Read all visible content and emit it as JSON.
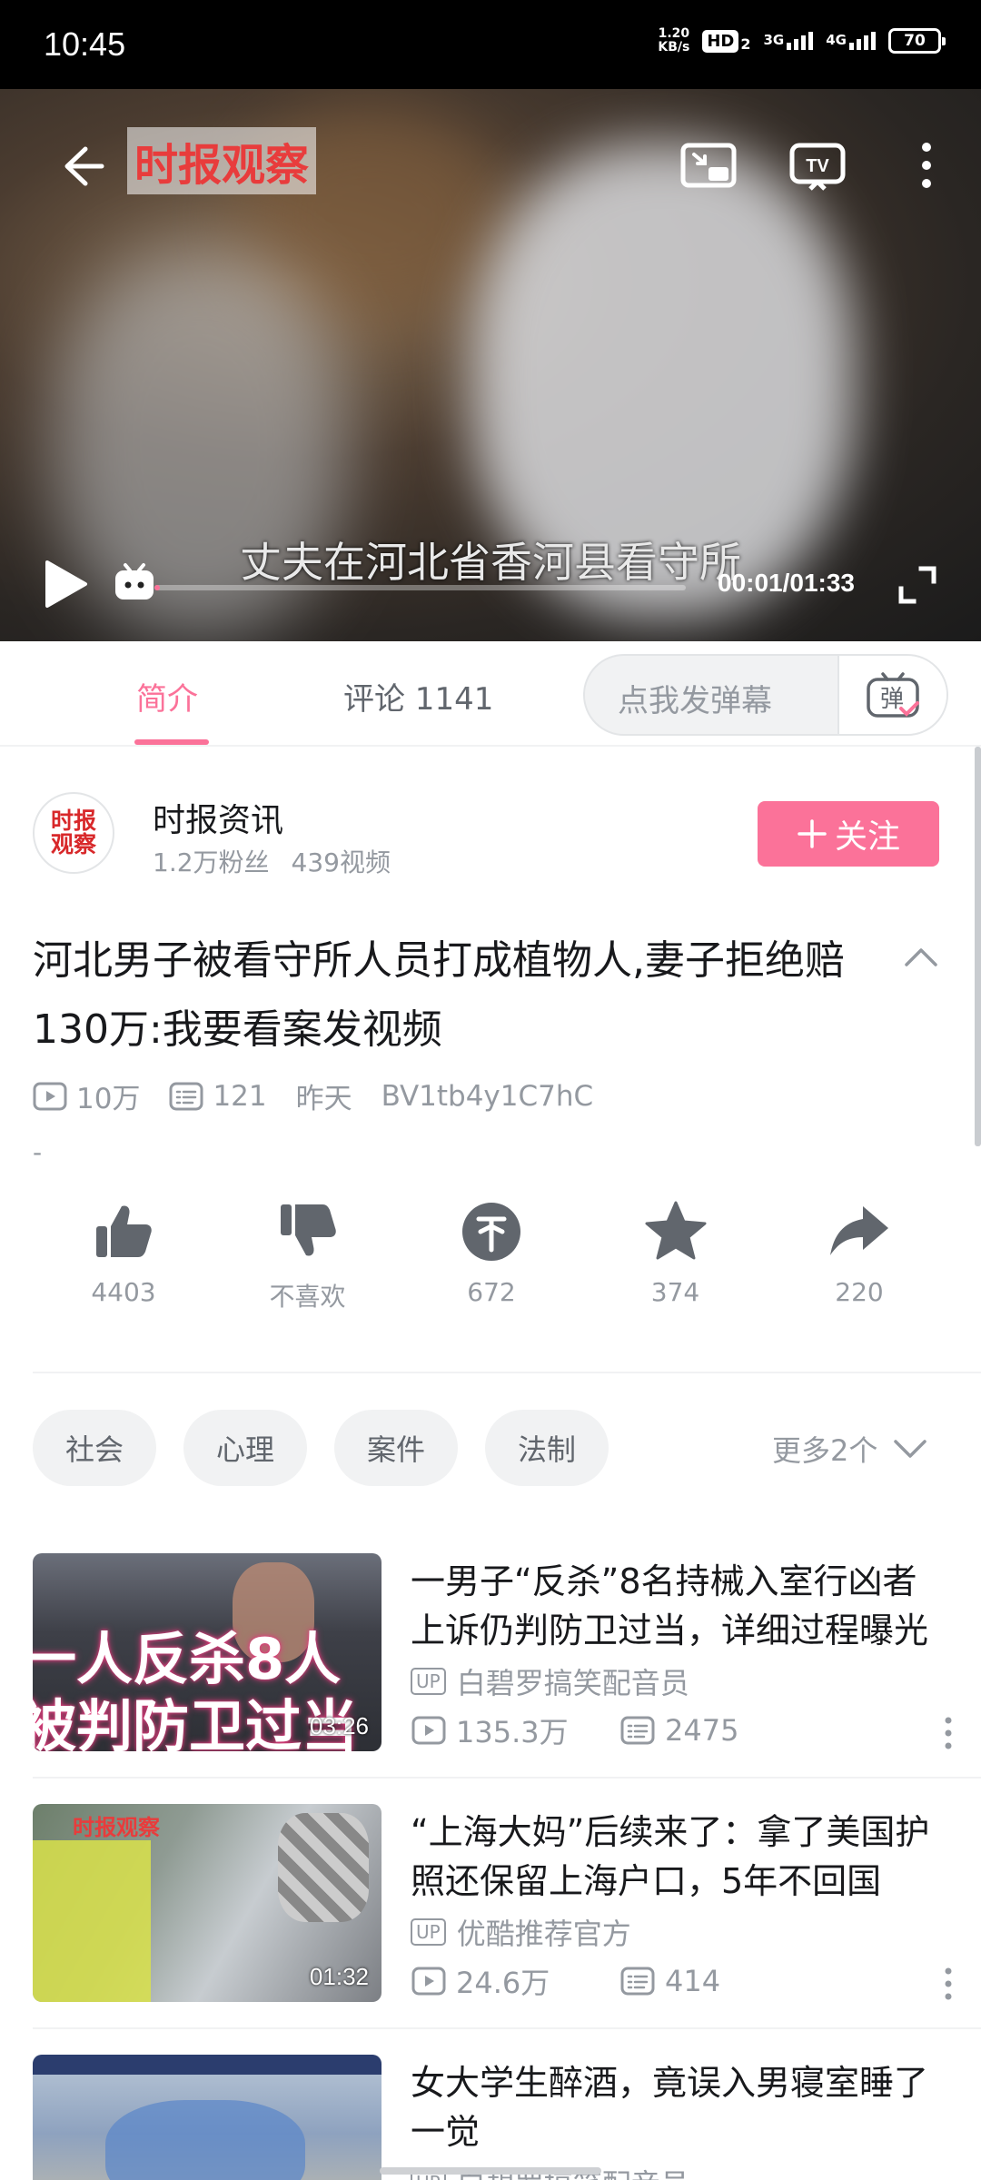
{
  "status_bar": {
    "time": "10:45",
    "net_speed_value": "1.20",
    "net_speed_unit": "KB/s",
    "hd": "HD",
    "hd_sub": "2",
    "sim1": "3G",
    "sim2": "4G",
    "battery": "70"
  },
  "player": {
    "logo": "时报观察",
    "subtitle": "丈夫在河北省香河县看守所",
    "time": "00:01/01:33",
    "progress": 0.011
  },
  "tabs": {
    "intro": "简介",
    "comments": "评论 1141",
    "danmaku_placeholder": "点我发弹幕",
    "danmaku_icon": "弹"
  },
  "uploader": {
    "name": "时报资讯",
    "avatar_text": "时报观察",
    "fans": "1.2万粉丝",
    "videos": "439视频",
    "follow_label": "关注"
  },
  "video": {
    "title": "河北男子被看守所人员打成植物人,妻子拒绝赔130万:我要看案发视频",
    "views": "10万",
    "danmaku_count": "121",
    "date": "昨天",
    "bvid": "BV1tb4y1C7hC",
    "desc": "-"
  },
  "actions": {
    "like": "4403",
    "dislike": "不喜欢",
    "coin": "672",
    "favorite": "374",
    "share": "220"
  },
  "tags": {
    "items": [
      "社会",
      "心理",
      "案件",
      "法制"
    ],
    "more": "更多2个"
  },
  "related": [
    {
      "title": "一男子“反杀”8名持械入室行凶者上诉仍判防卫过当，详细过程曝光",
      "uploader": "白碧罗搞笑配音员",
      "views": "135.3万",
      "danmaku": "2475",
      "duration": "03:26",
      "thumb_line1": "一人反杀8人",
      "thumb_line2": "被判防卫过当"
    },
    {
      "title": "“上海大妈”后续来了：拿了美国护照还保留上海户口，5年不回国",
      "uploader": "优酷推荐官方",
      "views": "24.6万",
      "danmaku": "414",
      "duration": "01:32",
      "thumb_logo": "时报观察"
    },
    {
      "title": "女大学生醉酒，竟误入男寝室睡了一觉",
      "uploader": "白碧罗搞笑配音员"
    }
  ],
  "colors": {
    "accent": "#fb7299",
    "text_primary": "#18191c",
    "text_secondary": "#9499a0",
    "background": "#ffffff"
  },
  "icons": [
    "back-icon",
    "pip-icon",
    "tv-cast-icon",
    "more-vert-icon",
    "play-icon",
    "danmaku-toggle-icon",
    "fullscreen-icon",
    "like-icon",
    "dislike-icon",
    "coin-icon",
    "favorite-icon",
    "share-icon",
    "chevron-up-icon",
    "chevron-down-icon",
    "play-count-icon",
    "danmaku-count-icon"
  ]
}
